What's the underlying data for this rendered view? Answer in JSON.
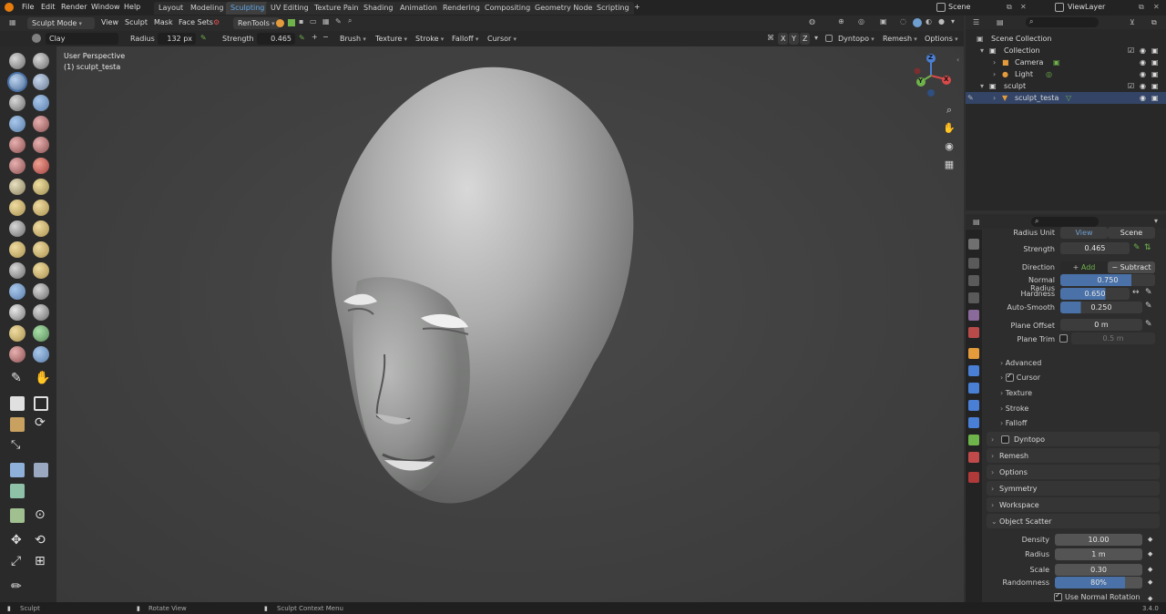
{
  "menu": {
    "file": "File",
    "edit": "Edit",
    "render": "Render",
    "window": "Window",
    "help": "Help"
  },
  "workspaces": [
    "Layout",
    "Modeling",
    "Sculpting",
    "UV Editing",
    "Texture Paint",
    "Shading",
    "Animation",
    "Rendering",
    "Compositing",
    "Geometry Nodes",
    "Scripting"
  ],
  "active_workspace": "Sculpting",
  "topbar_right": {
    "scene": "Scene",
    "view_layer": "ViewLayer",
    "add_tab": "+"
  },
  "header": {
    "mode": "Sculpt Mode",
    "view": "View",
    "sculpt": "Sculpt",
    "mask": "Mask",
    "face_sets": "Face Sets",
    "rentools": "RenTools"
  },
  "tool_settings": {
    "brush_name": "Clay",
    "radius_label": "Radius",
    "radius_value": "132 px",
    "strength_label": "Strength",
    "strength_value": "0.465",
    "brush": "Brush",
    "texture": "Texture",
    "stroke": "Stroke",
    "falloff": "Falloff",
    "cursor": "Cursor",
    "axis_x": "X",
    "axis_y": "Y",
    "axis_z": "Z",
    "dyntopo": "Dyntopo",
    "remesh": "Remesh",
    "options": "Options"
  },
  "viewport": {
    "perspective": "User Perspective",
    "object": "(1) sculpt_testa",
    "gizmo_x": "X",
    "gizmo_y": "Y",
    "gizmo_z": "Z"
  },
  "outliner": {
    "scene_collection": "Scene Collection",
    "collection": "Collection",
    "camera": "Camera",
    "light": "Light",
    "sculpt": "sculpt",
    "sculpt_obj": "sculpt_testa"
  },
  "properties": {
    "radius_unit_label": "Radius Unit",
    "view_btn": "View",
    "scene_btn": "Scene",
    "strength_label": "Strength",
    "strength": "0.465",
    "direction_label": "Direction",
    "add": "Add",
    "subtract": "Subtract",
    "normal_radius_label": "Normal Radius",
    "normal_radius": "0.750",
    "hardness_label": "Hardness",
    "hardness": "0.650",
    "autosmooth_label": "Auto-Smooth",
    "autosmooth": "0.250",
    "plane_offset_label": "Plane Offset",
    "plane_offset": "0 m",
    "plane_trim_label": "Plane Trim",
    "plane_trim": "0.5 m",
    "advanced": "Advanced",
    "cursor": "Cursor",
    "texture": "Texture",
    "stroke": "Stroke",
    "falloff": "Falloff",
    "dyntopo": "Dyntopo",
    "remesh": "Remesh",
    "options": "Options",
    "symmetry": "Symmetry",
    "workspace": "Workspace",
    "object_scatter": "Object Scatter",
    "density_label": "Density",
    "density": "10.00",
    "radius_label": "Radius",
    "radius": "1 m",
    "scale_label": "Scale",
    "scale": "0.30",
    "randomness_label": "Randomness",
    "randomness": "80%",
    "use_normal_rotation": "Use Normal Rotation"
  },
  "statusbar": {
    "left": "Sculpt",
    "middle": "Rotate View",
    "context": "Sculpt Context Menu",
    "version": "3.4.0"
  },
  "colors": {
    "accent": "#5fa8e8",
    "active_tool": "#4a72a8",
    "background": "#303030"
  }
}
